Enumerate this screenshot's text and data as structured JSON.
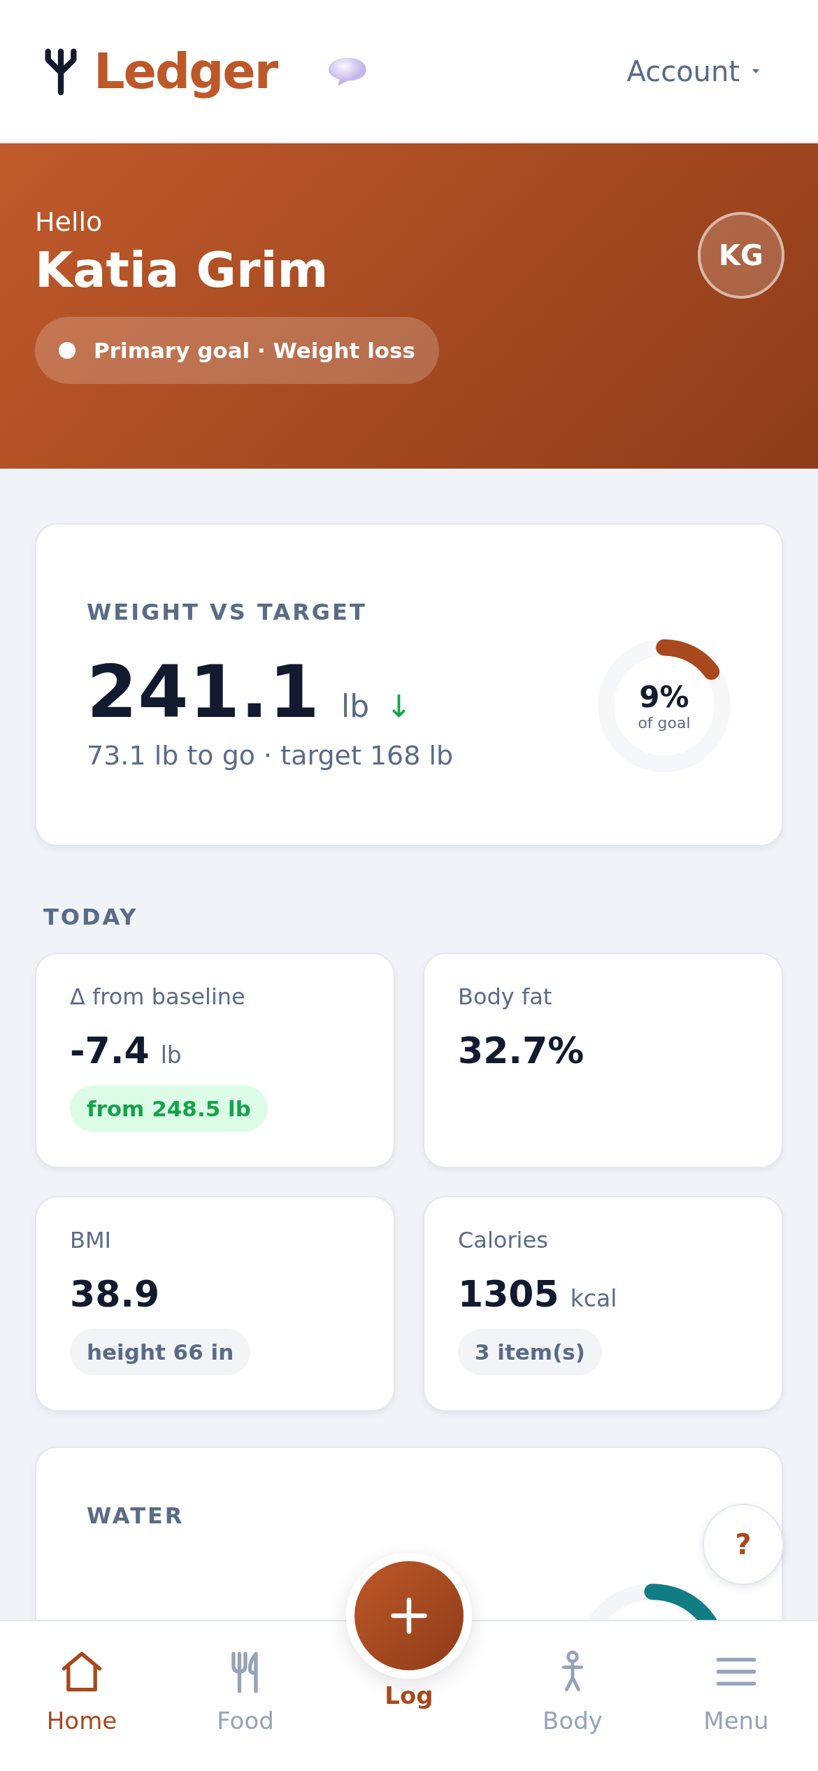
{
  "header": {
    "logo": "Ledger",
    "account": "Account"
  },
  "hero": {
    "greeting": "Hello",
    "name": "Katia Grim",
    "initials": "KG",
    "goal": "Primary goal · Weight loss"
  },
  "weight": {
    "title": "WEIGHT VS TARGET",
    "value": "241.1",
    "unit": "lb",
    "trend": "↓",
    "subtitle": "73.1 lb to go · target 168 lb",
    "percent": "9%",
    "percent_label": "of goal",
    "level": 0.15
  },
  "today": {
    "title": "TODAY",
    "cards": [
      {
        "label": "Δ from baseline",
        "value": "-7.4",
        "unit": "lb",
        "chip": "from 248.5 lb",
        "kind": "positive"
      },
      {
        "label": "Body fat",
        "value": "32.7%"
      },
      {
        "label": "BMI",
        "value": "38.9",
        "chip": "height 66 in",
        "kind": "neutral"
      },
      {
        "label": "Calories",
        "value": "1305",
        "unit": "kcal",
        "chip": "3 item(s)",
        "kind": "neutral"
      }
    ]
  },
  "water": {
    "title": "WATER"
  },
  "help": "?",
  "nav": [
    {
      "label": "Home",
      "selected": true
    },
    {
      "label": "Food",
      "selected": false
    },
    {
      "label": "Log",
      "kind": "fab"
    },
    {
      "label": "Body",
      "selected": false
    },
    {
      "label": "Menu",
      "selected": false
    }
  ]
}
